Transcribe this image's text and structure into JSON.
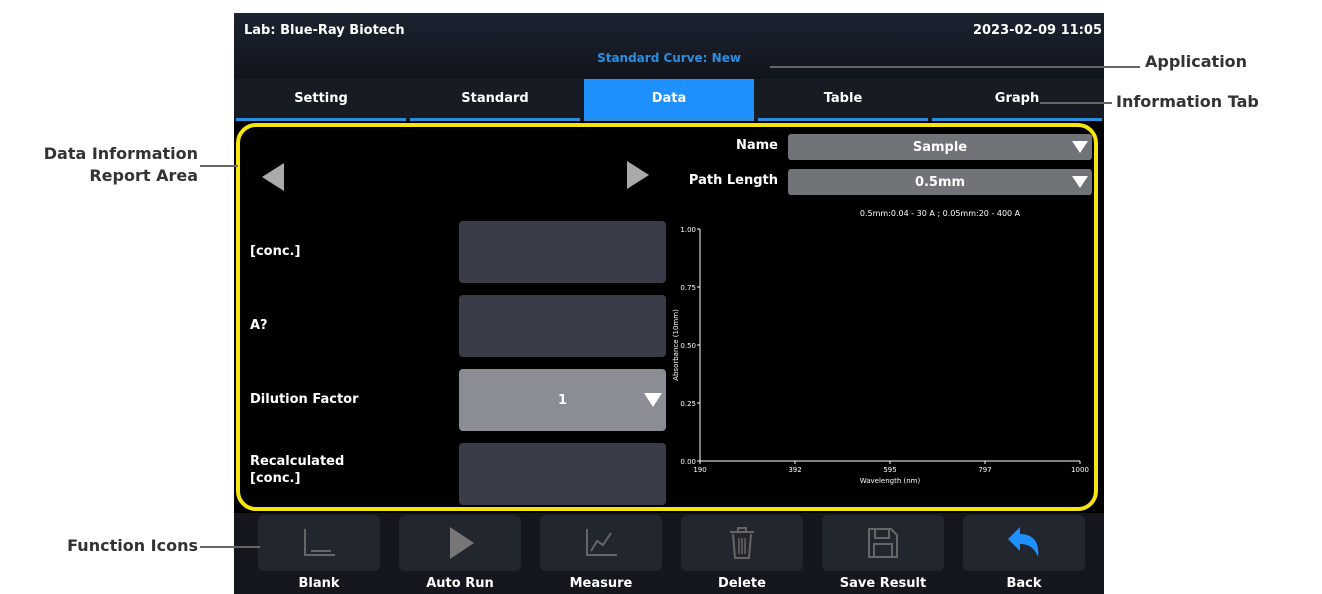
{
  "header": {
    "lab": "Lab: Blue-Ray Biotech",
    "datetime": "2023-02-09 11:05",
    "app_title": "Standard Curve: New"
  },
  "tabs": [
    {
      "label": "Setting",
      "active": false
    },
    {
      "label": "Standard",
      "active": false
    },
    {
      "label": "Data",
      "active": true
    },
    {
      "label": "Table",
      "active": false
    },
    {
      "label": "Graph",
      "active": false
    }
  ],
  "fields": {
    "conc_label": "[conc.]",
    "a_label": "A?",
    "dilution_label": "Dilution Factor",
    "dilution_value": "1",
    "recalc_label_line1": "Recalculated",
    "recalc_label_line2": "[conc.]"
  },
  "selectors": {
    "name_label": "Name",
    "name_value": "Sample",
    "path_label": "Path Length",
    "path_value": "0.5mm",
    "range_note": "0.5mm:0.04 - 30 A ; 0.05mm:20 - 400 A"
  },
  "chart_data": {
    "type": "line",
    "xlabel": "Wavelength (nm)",
    "ylabel": "Absorbance (10mm)",
    "xlim": [
      190,
      1000
    ],
    "ylim": [
      0,
      1
    ],
    "x_ticks": [
      "190",
      "392",
      "595",
      "797",
      "1000"
    ],
    "y_ticks": [
      "0.00",
      "0.25",
      "0.50",
      "0.75",
      "1.00"
    ],
    "series": []
  },
  "toolbar": [
    {
      "label": "Blank",
      "icon": "blank-icon"
    },
    {
      "label": "Auto Run",
      "icon": "play-icon"
    },
    {
      "label": "Measure",
      "icon": "measure-icon"
    },
    {
      "label": "Delete",
      "icon": "trash-icon"
    },
    {
      "label": "Save Result",
      "icon": "save-icon"
    },
    {
      "label": "Back",
      "icon": "back-arrow-icon"
    }
  ],
  "annotations": {
    "application": "Application",
    "information_tab": "Information Tab",
    "data_area_line1": "Data Information",
    "data_area_line2": "Report Area",
    "function_icons": "Function Icons"
  },
  "colors": {
    "accent": "#1e90ff",
    "highlight": "#f5e50d",
    "app_title": "#2a8fe0"
  }
}
